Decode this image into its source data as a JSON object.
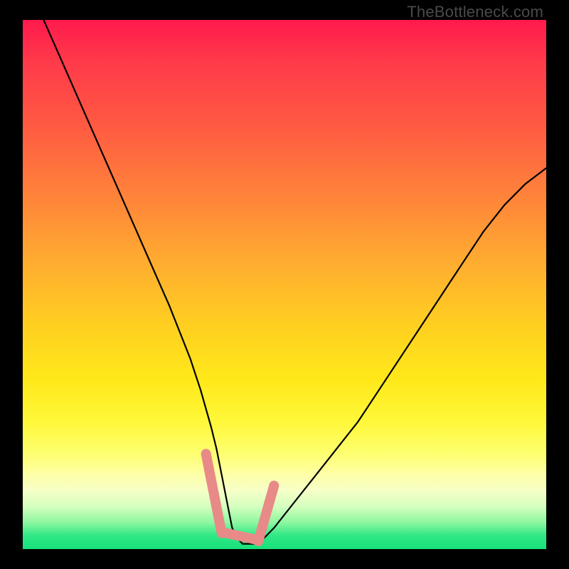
{
  "watermark": "TheBottleneck.com",
  "chart_data": {
    "type": "line",
    "title": "",
    "xlabel": "",
    "ylabel": "",
    "xlim": [
      0,
      100
    ],
    "ylim": [
      0,
      100
    ],
    "series": [
      {
        "name": "curve",
        "x": [
          4,
          8,
          12,
          16,
          20,
          24,
          28,
          32,
          34,
          36,
          37,
          38,
          39,
          40,
          41,
          42,
          43,
          44,
          45,
          46,
          48,
          52,
          56,
          60,
          64,
          68,
          72,
          76,
          80,
          84,
          88,
          92,
          96,
          100
        ],
        "y": [
          100,
          91,
          82,
          73,
          64,
          55,
          46,
          36,
          30,
          23,
          19,
          14,
          9,
          4,
          2,
          1,
          1,
          1,
          1,
          2,
          4,
          9,
          14,
          19,
          24,
          30,
          36,
          42,
          48,
          54,
          60,
          65,
          69,
          72
        ]
      }
    ],
    "mask": {
      "comment": "salmon overlay segment near valley",
      "x": [
        35,
        36,
        37,
        38,
        39,
        40,
        41,
        42,
        43,
        44,
        45,
        46,
        47,
        48
      ],
      "y": [
        18,
        12,
        7,
        3,
        1.5,
        1,
        1,
        1,
        1,
        1,
        1.5,
        3,
        7,
        12
      ]
    },
    "colors": {
      "curve": "#000000",
      "mask": "#e88a88",
      "gradient_top": "#ff1a4d",
      "gradient_mid": "#ffe81a",
      "gradient_bottom": "#17e07a"
    }
  }
}
